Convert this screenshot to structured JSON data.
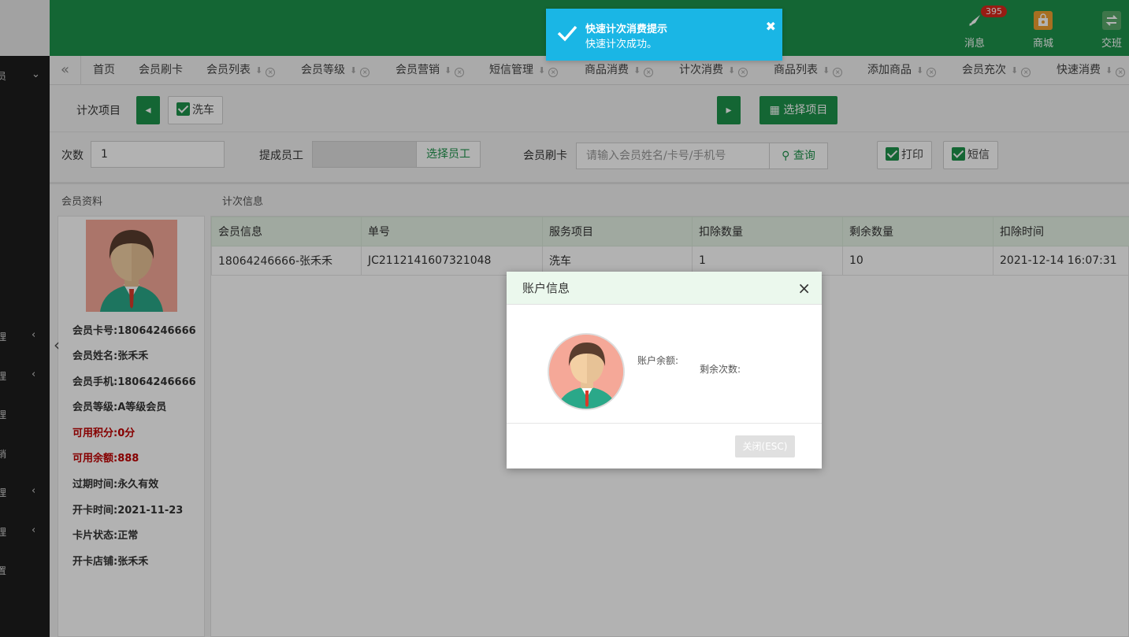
{
  "sidebar": {
    "items": [
      {
        "glyph": "员",
        "caret": "⌄"
      },
      {
        "glyph": "理",
        "caret": "‹"
      },
      {
        "glyph": "理",
        "caret": "‹"
      },
      {
        "glyph": "理",
        "caret": ""
      },
      {
        "glyph": "销",
        "caret": ""
      },
      {
        "glyph": "理",
        "caret": "‹"
      },
      {
        "glyph": "理",
        "caret": "‹"
      },
      {
        "glyph": "置",
        "caret": ""
      }
    ]
  },
  "header": {
    "icons": [
      {
        "label": "消息",
        "badge": "395",
        "color": "#1e934b",
        "icon": "rocket-icon"
      },
      {
        "label": "商城",
        "badge": "",
        "color": "#f0a030",
        "icon": "shop-icon"
      },
      {
        "label": "交班",
        "badge": "",
        "color": "#5aaa6a",
        "icon": "exchange-icon"
      }
    ]
  },
  "tabs": [
    {
      "label": "首页"
    },
    {
      "label": "会员刷卡"
    },
    {
      "label": "会员列表"
    },
    {
      "label": "会员等级"
    },
    {
      "label": "会员营销"
    },
    {
      "label": "短信管理"
    },
    {
      "label": "商品消费"
    },
    {
      "label": "计次消费"
    },
    {
      "label": "商品列表"
    },
    {
      "label": "添加商品"
    },
    {
      "label": "会员充次"
    },
    {
      "label": "快速消费"
    }
  ],
  "toolbar": {
    "item_label": "计次项目",
    "checked_item": "洗车",
    "select_project": "选择项目",
    "count_label": "次数",
    "count_value": "1",
    "staff_label": "提成员工",
    "select_staff": "选择员工",
    "card_label": "会员刷卡",
    "search_placeholder": "请输入会员姓名/卡号/手机号",
    "query": "查询",
    "print": "打印",
    "sms": "短信"
  },
  "member": {
    "section": "会员资料",
    "fields": [
      "会员卡号:18064246666",
      "会员姓名:张禾禾",
      "会员手机:18064246666",
      "会员等级:A等级会员",
      "可用积分:0分",
      "可用余额:888",
      "过期时间:永久有效",
      "开卡时间:2021-11-23",
      "卡片状态:正常",
      "开卡店铺:张禾禾"
    ]
  },
  "records": {
    "section": "计次信息",
    "columns": [
      "会员信息",
      "单号",
      "服务项目",
      "扣除数量",
      "剩余数量",
      "扣除时间"
    ],
    "rows": [
      [
        "18064246666-张禾禾",
        "JC2112141607321048",
        "洗车",
        "1",
        "10",
        "2021-12-14 16:07:31"
      ]
    ]
  },
  "dialog": {
    "title": "账户信息",
    "balance_label": "账户余额:",
    "remaining_label": "剩余次数:",
    "close_button": "关闭(ESC)"
  },
  "toast": {
    "title": "快速计次消费提示",
    "message": "快速计次成功。"
  }
}
